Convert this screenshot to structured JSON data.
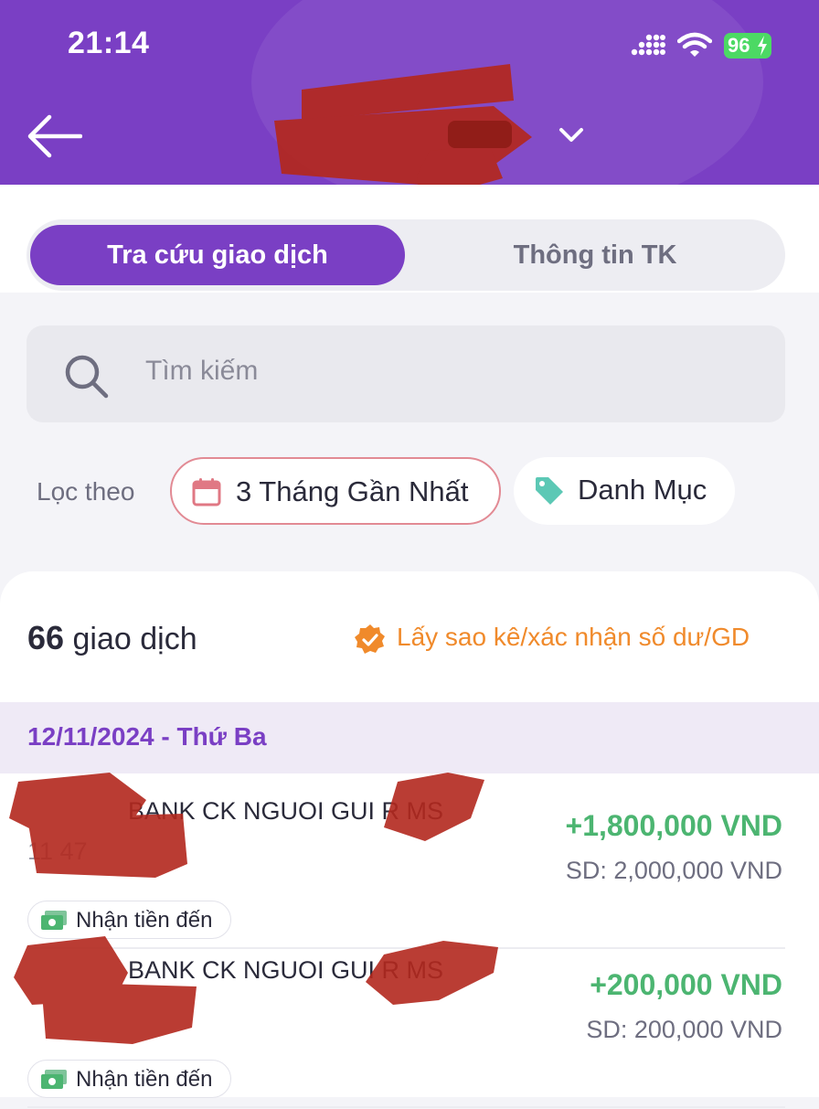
{
  "status_bar": {
    "time": "21:14",
    "battery": "96"
  },
  "header": {
    "title": ""
  },
  "tabs": [
    {
      "label": "Tra cứu giao dịch",
      "active": true
    },
    {
      "label": "Thông tin TK",
      "active": false
    }
  ],
  "search": {
    "placeholder": "Tìm kiếm"
  },
  "filters": {
    "label": "Lọc theo",
    "date_chip": "3 Tháng Gần Nhất",
    "category_chip": "Danh Mục"
  },
  "summary": {
    "count": "66",
    "count_suffix": "giao dịch",
    "statement_link": "Lấy sao kê/xác nhận số dư/GD"
  },
  "date_group": "12/11/2024 - Thứ Ba",
  "transactions": [
    {
      "description": "BANK CK NGUOI GUI R MS",
      "description_line2": "11 47",
      "amount": "+1,800,000 VND",
      "balance": "SD: 2,000,000 VND",
      "type": "Nhận tiền đến"
    },
    {
      "description": "BANK CK NGUOI GUI R MS",
      "description_line2": "",
      "amount": "+200,000 VND",
      "balance": "SD: 200,000 VND",
      "type": "Nhận tiền đến"
    }
  ],
  "colors": {
    "brand": "#7a3fc4",
    "positive": "#4cb571",
    "accent_orange": "#f08a2b",
    "redaction": "#b3281e"
  },
  "icons": [
    "back-arrow-icon",
    "chevron-down-icon",
    "search-icon",
    "calendar-icon",
    "tag-icon",
    "verified-badge-icon",
    "money-icon"
  ]
}
